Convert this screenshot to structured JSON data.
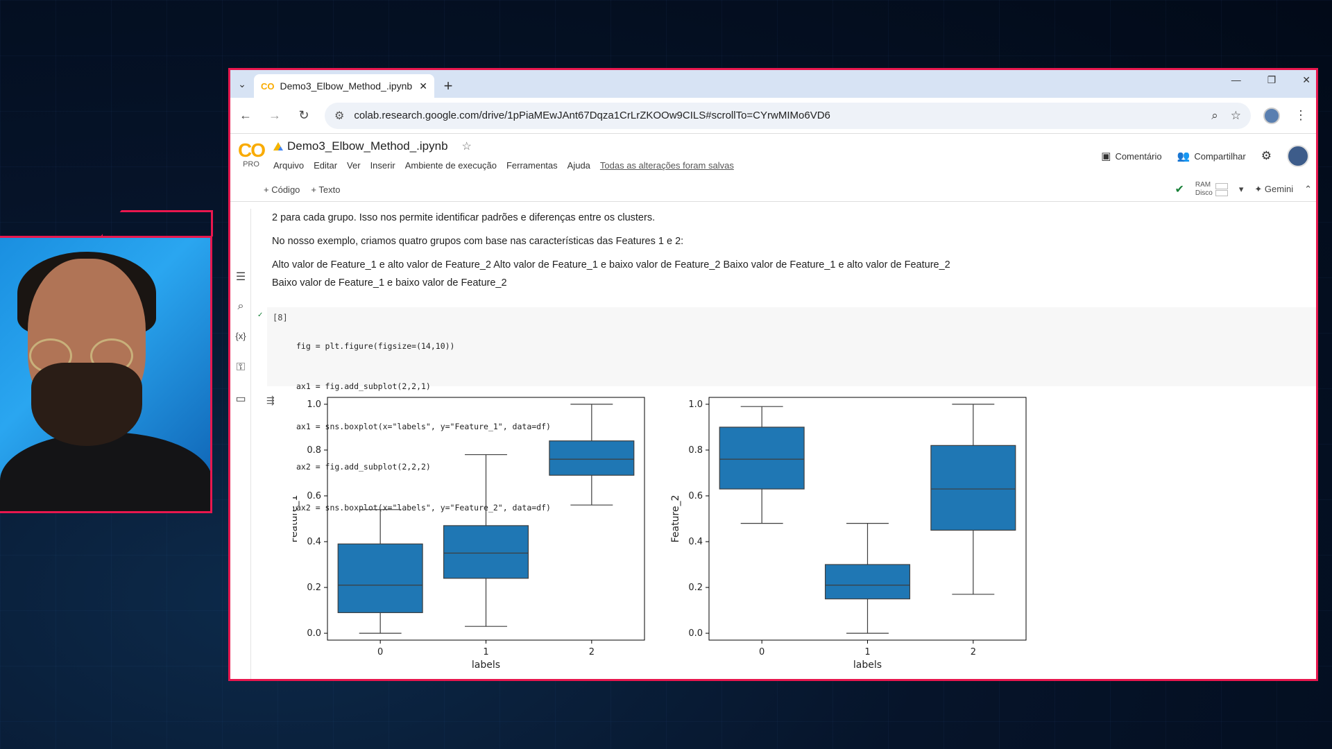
{
  "browser": {
    "tab_title": "Demo3_Elbow_Method_.ipynb",
    "url": "colab.research.google.com/drive/1pPiaMEwJAnt67Dqza1CrLrZKOOw9CILS#scrollTo=CYrwMIMo6VD6"
  },
  "colab": {
    "logo": "CO",
    "tier": "PRO",
    "notebook_title": "Demo3_Elbow_Method_.ipynb",
    "menu": [
      "Arquivo",
      "Editar",
      "Ver",
      "Inserir",
      "Ambiente de execução",
      "Ferramentas",
      "Ajuda"
    ],
    "saved_status": "Todas as alterações foram salvas",
    "comment_label": "Comentário",
    "share_label": "Compartilhar",
    "add_code": "+ Código",
    "add_text": "+ Texto",
    "ram_label": "RAM",
    "disk_label": "Disco",
    "gemini_label": "✦ Gemini"
  },
  "text_cell": {
    "p1": "2 para cada grupo. Isso nos permite identificar padrões e diferenças entre os clusters.",
    "p2": "No nosso exemplo, criamos quatro grupos com base nas características das Features 1 e 2:",
    "p3": "Alto valor de Feature_1 e alto valor de Feature_2 Alto valor de Feature_1 e baixo valor de Feature_2 Baixo valor de Feature_1 e alto valor de Feature_2 Baixo valor de Feature_1 e baixo valor de Feature_2"
  },
  "code_cell": {
    "exec_count": "[8]",
    "lines": [
      "fig = plt.figure(figsize=(14,10))",
      "ax1 = fig.add_subplot(2,2,1)",
      "ax1 = sns.boxplot(x=\"labels\", y=\"Feature_1\", data=df)",
      "ax2 = fig.add_subplot(2,2,2)",
      "ax2 = sns.boxplot(x=\"labels\", y=\"Feature_2\", data=df)"
    ]
  },
  "chart_data": [
    {
      "type": "boxplot",
      "xlabel": "labels",
      "ylabel": "Feature_1",
      "categories": [
        "0",
        "1",
        "2"
      ],
      "ylim": [
        -0.03,
        1.03
      ],
      "yticks": [
        0.0,
        0.2,
        0.4,
        0.6,
        0.8,
        1.0
      ],
      "boxes": [
        {
          "whisker_low": 0.0,
          "q1": 0.09,
          "median": 0.21,
          "q3": 0.39,
          "whisker_high": 0.54
        },
        {
          "whisker_low": 0.03,
          "q1": 0.24,
          "median": 0.35,
          "q3": 0.47,
          "whisker_high": 0.78
        },
        {
          "whisker_low": 0.56,
          "q1": 0.69,
          "median": 0.76,
          "q3": 0.84,
          "whisker_high": 1.0
        }
      ],
      "color": "#1f77b4"
    },
    {
      "type": "boxplot",
      "xlabel": "labels",
      "ylabel": "Feature_2",
      "categories": [
        "0",
        "1",
        "2"
      ],
      "ylim": [
        -0.03,
        1.03
      ],
      "yticks": [
        0.0,
        0.2,
        0.4,
        0.6,
        0.8,
        1.0
      ],
      "boxes": [
        {
          "whisker_low": 0.48,
          "q1": 0.63,
          "median": 0.76,
          "q3": 0.9,
          "whisker_high": 0.99
        },
        {
          "whisker_low": 0.0,
          "q1": 0.15,
          "median": 0.21,
          "q3": 0.3,
          "whisker_high": 0.48
        },
        {
          "whisker_low": 0.17,
          "q1": 0.45,
          "median": 0.63,
          "q3": 0.82,
          "whisker_high": 1.0
        }
      ],
      "color": "#1f77b4"
    }
  ]
}
